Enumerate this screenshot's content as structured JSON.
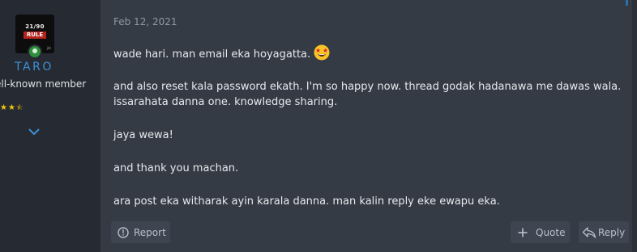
{
  "user": {
    "avatar_line1": "21/90",
    "avatar_line2": "RULE",
    "avatar_small": "jkt",
    "name": "TARO",
    "title": "ell-known member",
    "stars": "★★",
    "half_star": "⯪"
  },
  "post": {
    "date": "Feb 12, 2021",
    "paragraphs": [
      "wade hari. man email eka hoyagatta.",
      "and also reset kala password ekath. I'm so happy now. thread godak hadanawa me dawas wala. issarahata danna one. knowledge sharing.",
      "jaya wewa!",
      "and thank you machan.",
      "ara post eka witharak ayin karala danna. man kalin reply eke ewapu eka."
    ]
  },
  "actions": {
    "report": "Report",
    "quote": "Quote",
    "reply": "Reply"
  },
  "icons": {
    "expand": "chevron-down-icon",
    "report": "alert-circle-icon",
    "quote": "plus-icon",
    "reply": "reply-arrow-icon",
    "emoji": "star-struck-emoji",
    "online": "online-status-icon"
  },
  "colors": {
    "accent": "#3d8fd6",
    "star": "#f1c40f",
    "online": "#2f8f3a"
  }
}
